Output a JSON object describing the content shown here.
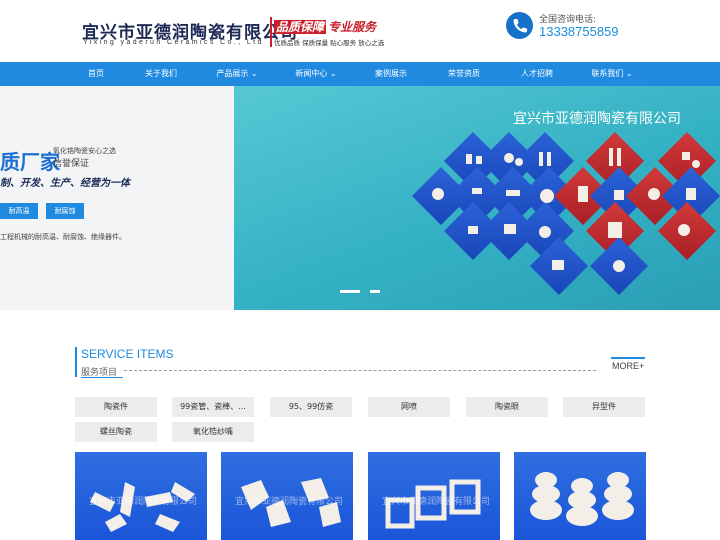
{
  "header": {
    "logo_cn": "宜兴市亚德润陶瓷有限公司",
    "logo_en": "Yixing yaderun Ceramics Co., Ltd",
    "slogan_a": "品质保障",
    "slogan_b": "专业服务",
    "slogan_sub": "优质品质  保质保量  贴心服务  放心之选",
    "phone_label": "全国咨询电话:",
    "phone_number": "13338755859",
    "phone_icon": "phone-icon"
  },
  "nav": {
    "items": [
      {
        "label": "首页"
      },
      {
        "label": "关于我们"
      },
      {
        "label": "产品展示 ⌄"
      },
      {
        "label": "新闻中心 ⌄"
      },
      {
        "label": "案例展示"
      },
      {
        "label": "荣誉资质"
      },
      {
        "label": "人才招聘"
      },
      {
        "label": "联系我们 ⌄"
      }
    ]
  },
  "banner": {
    "left_title": "质厂家",
    "left_side_1": "氧化锆陶瓷安心之选",
    "left_side_2": "信誉保证",
    "left_tagline": "制、开发、生产、经营为一体",
    "btn_1": "耐高温",
    "btn_2": "耐腐蚀",
    "left_desc": "工程机械的耐高温、耐腐蚀、绝缘器件。",
    "right_title": "宜兴市亚德润陶瓷有限公司"
  },
  "service": {
    "title_en": "SERVICE ITEMS",
    "title_cn": "服务项目",
    "more": "MORE+"
  },
  "categories": [
    "陶瓷件",
    "99瓷管、瓷棒、...",
    "95、99仿瓷",
    "网喷",
    "陶瓷眼",
    "异型件",
    "螺丝陶瓷",
    "氧化锆纱嘴"
  ],
  "products": {
    "watermark": "宜兴市亚德润陶瓷有限公司"
  },
  "colors": {
    "nav_blue": "#1f8ae0",
    "brand_red": "#c8202a",
    "banner_teal": "#3fb8c9"
  }
}
